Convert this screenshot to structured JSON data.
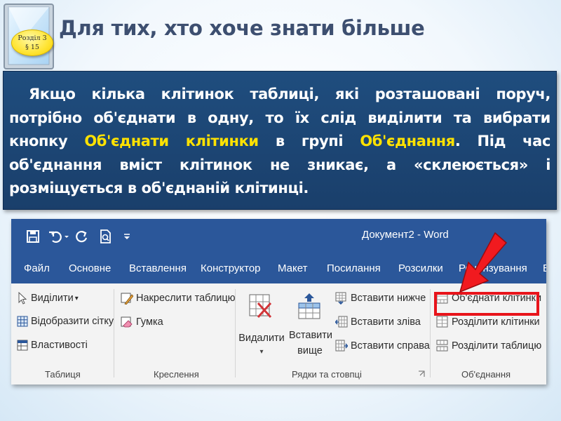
{
  "slide": {
    "title": "Для тих, хто хоче знати більше",
    "badge_line1": "Розділ 3",
    "badge_line2": "§ 15",
    "paragraph": {
      "part1": "Якщо кілька клітинок таблиці, які розташовані поруч, потрібно об'єднати в одну, то їх слід виділити та вибрати кнопку ",
      "hl1": "Об'єднати клітинки",
      "part2": " в групі ",
      "hl2": "Об'єднання",
      "part3": ". Під час об'єднання вміст клітинок не зникає, а «склеюється» і розміщується в об'єднаній клітинці."
    },
    "highlight_color": "#ffe200",
    "box_color": "#1f4d7e"
  },
  "word": {
    "title": "Документ2 - Word",
    "qat_icons": [
      "save-icon",
      "undo-icon",
      "redo-icon",
      "print-preview-icon",
      "customize-icon"
    ],
    "menu": [
      "Файл",
      "Основне",
      "Вставлення",
      "Конструктор",
      "Макет",
      "Посилання",
      "Розсилки",
      "Рецензування",
      "В"
    ],
    "menu_partial": "В",
    "groups": {
      "table": {
        "label": "Таблиця",
        "select": "Виділити",
        "gridlines": "Відобразити сітку",
        "properties": "Властивості"
      },
      "draw": {
        "label": "Креслення",
        "draw_table": "Накреслити таблицю",
        "eraser": "Гумка"
      },
      "rows_cols": {
        "label": "Рядки та стовпці",
        "delete": "Видалити",
        "insert_above_1": "Вставити",
        "insert_above_2": "вище",
        "insert_below": "Вставити нижче",
        "insert_left": "Вставити зліва",
        "insert_right": "Вставити справа"
      },
      "merge": {
        "label": "Об'єднання",
        "merge_cells": "Об'єднати клітинки",
        "split_cells": "Розділити клітинки",
        "split_table": "Розділити таблицю"
      }
    },
    "accent_color": "#2b579a",
    "callout_color": "#e8141b"
  }
}
